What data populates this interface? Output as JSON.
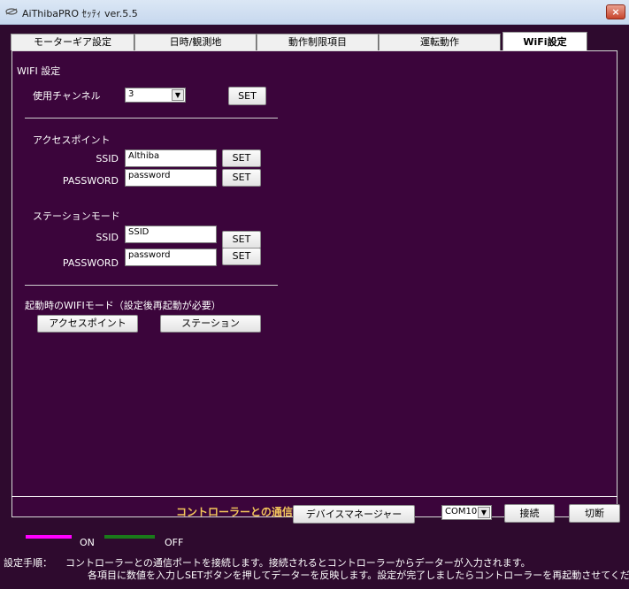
{
  "window": {
    "title": "AiThibaPRO ｾｯﾃｨ ver.5.5",
    "close_label": "×"
  },
  "tabs": [
    "モーターギア設定",
    "日時/観測地",
    "動作制限項目",
    "運転動作",
    "WiFi設定"
  ],
  "wifi": {
    "section_title": "WIFI 設定",
    "channel": {
      "label": "使用チャンネル",
      "value": "3",
      "set_label": "SET"
    },
    "access_point": {
      "title": "アクセスポイント",
      "ssid_label": "SSID",
      "ssid_value": "Althiba",
      "password_label": "PASSWORD",
      "password_value": "password",
      "set_label": "SET"
    },
    "station": {
      "title": "ステーションモード",
      "ssid_label": "SSID",
      "ssid_value": "SSID",
      "password_label": "PASSWORD",
      "password_value": "password",
      "set_label": "SET"
    },
    "startup_mode": {
      "title": "起動時のWIFIモード（設定後再起動が必要）",
      "ap_button": "アクセスポイント",
      "station_button": "ステーション"
    }
  },
  "connection": {
    "label": "コントローラーとの通信",
    "device_manager_button": "デバイスマネージャー",
    "port_value": "COM10",
    "connect_button": "接続",
    "disconnect_button": "切断"
  },
  "legend": {
    "on_label": "ON",
    "off_label": "OFF",
    "on_color": "#ff00ff",
    "off_color": "#1a7a1a"
  },
  "steps": {
    "heading": "設定手順：",
    "line1": "コントローラーとの通信ポートを接続します。接続されるとコントローラーからデーターが入力されます。",
    "line2": "各項目に数値を入力しSETボタンを押してデーターを反映します。設定が完了しましたらコントローラーを再起動させてください。"
  }
}
